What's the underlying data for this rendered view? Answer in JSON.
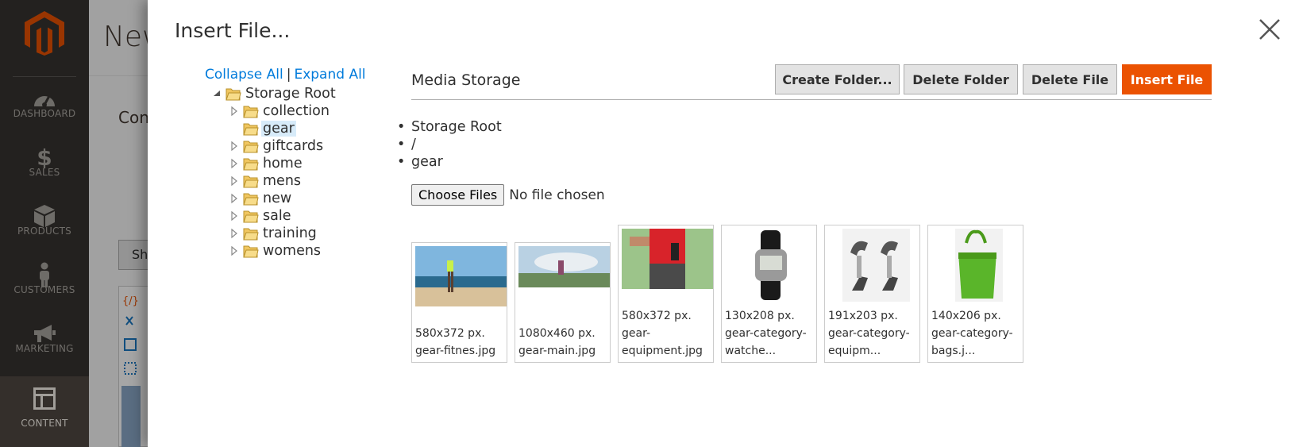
{
  "admin_nav": {
    "items": [
      {
        "label": "DASHBOARD",
        "icon": "dashboard-gauge-icon"
      },
      {
        "label": "SALES",
        "icon": "dollar-icon"
      },
      {
        "label": "PRODUCTS",
        "icon": "box-icon"
      },
      {
        "label": "CUSTOMERS",
        "icon": "person-icon"
      },
      {
        "label": "MARKETING",
        "icon": "megaphone-icon"
      },
      {
        "label": "CONTENT",
        "icon": "layout-icon"
      }
    ],
    "active": "CONTENT",
    "colors": {
      "background": "#373330",
      "active": "#514943",
      "text": "#aaa6a0",
      "brand": "#eb5202"
    }
  },
  "background_page": {
    "title_fragment": "New",
    "section_fragment": "Con",
    "button_fragment": "Sh"
  },
  "modal": {
    "title": "Insert File...",
    "close_icon": "close-x-icon"
  },
  "tree": {
    "collapse_all": "Collapse All",
    "separator": "|",
    "expand_all": "Expand All",
    "root": "Storage Root",
    "folders": [
      "collection",
      "gear",
      "giftcards",
      "home",
      "mens",
      "new",
      "sale",
      "training",
      "womens"
    ],
    "selected": "gear"
  },
  "browser": {
    "heading": "Media Storage",
    "buttons": {
      "create_folder": "Create Folder...",
      "delete_folder": "Delete Folder",
      "delete_file": "Delete File",
      "insert_file": "Insert File"
    },
    "breadcrumbs": [
      "Storage Root",
      "/",
      "gear"
    ],
    "upload": {
      "button": "Choose Files",
      "status": "No file chosen"
    },
    "files": [
      {
        "size": "580x372 px.",
        "name_lines": [
          "gear-fitnes.jpg"
        ]
      },
      {
        "size": "1080x460 px.",
        "name_lines": [
          "gear-main.jpg"
        ]
      },
      {
        "size": "580x372 px.",
        "name_lines": [
          "gear-",
          "equipment.jpg"
        ]
      },
      {
        "size": "130x208 px.",
        "name_lines": [
          "gear-category-",
          "watche..."
        ]
      },
      {
        "size": "191x203 px.",
        "name_lines": [
          "gear-category-",
          "equipm..."
        ]
      },
      {
        "size": "140x206 px.",
        "name_lines": [
          "gear-category-",
          "bags.j..."
        ]
      }
    ]
  }
}
